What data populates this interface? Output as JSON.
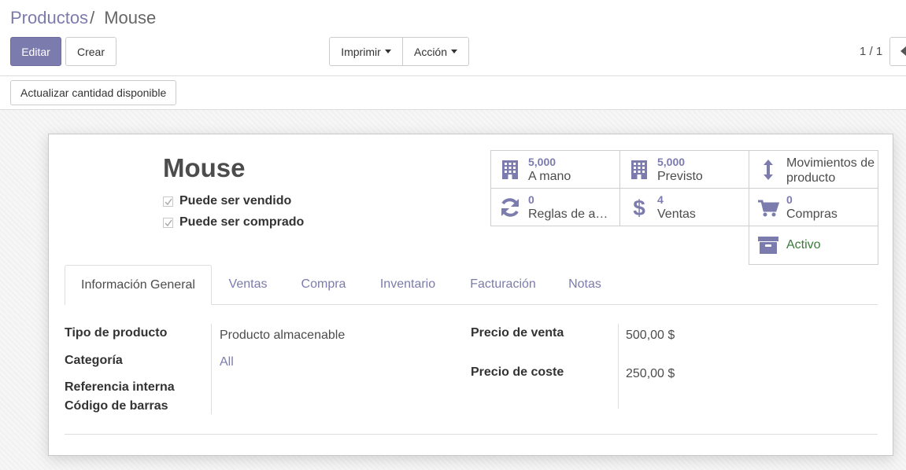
{
  "breadcrumb": {
    "parent": "Productos",
    "separator": "/",
    "current": "Mouse"
  },
  "toolbar": {
    "edit": "Editar",
    "create": "Crear",
    "print": "Imprimir",
    "action": "Acción",
    "pager": "1 / 1"
  },
  "statusbar": {
    "update_qty": "Actualizar cantidad disponible"
  },
  "product": {
    "name": "Mouse",
    "can_be_sold": {
      "label": "Puede ser vendido",
      "checked": true
    },
    "can_be_purchased": {
      "label": "Puede ser comprado",
      "checked": true
    }
  },
  "smart_buttons": {
    "on_hand": {
      "value": "5,000",
      "label": "A mano",
      "icon": "building-icon"
    },
    "forecast": {
      "value": "5,000",
      "label": "Previsto",
      "icon": "building-icon"
    },
    "moves": {
      "label": "Movimientos de producto",
      "icon": "arrows-vertical-icon"
    },
    "reorder": {
      "value": "0",
      "label": "Reglas de ab…",
      "icon": "refresh-icon"
    },
    "sales": {
      "value": "4",
      "label": "Ventas",
      "icon": "dollar-icon"
    },
    "purchases": {
      "value": "0",
      "label": "Compras",
      "icon": "cart-icon"
    },
    "active": {
      "label": "Activo",
      "icon": "archive-icon",
      "color": "#3a7a3a"
    }
  },
  "tabs": [
    "Información General",
    "Ventas",
    "Compra",
    "Inventario",
    "Facturación",
    "Notas"
  ],
  "general": {
    "type_label": "Tipo de producto",
    "type_value": "Producto almacenable",
    "category_label": "Categoría",
    "category_value": "All",
    "ref_label": "Referencia interna",
    "barcode_label": "Código de barras",
    "sale_price_label": "Precio de venta",
    "sale_price_value": "500,00 $",
    "cost_label": "Precio de coste",
    "cost_value": "250,00 $"
  },
  "colors": {
    "accent": "#7c7bad",
    "active_green": "#3a7a3a"
  }
}
